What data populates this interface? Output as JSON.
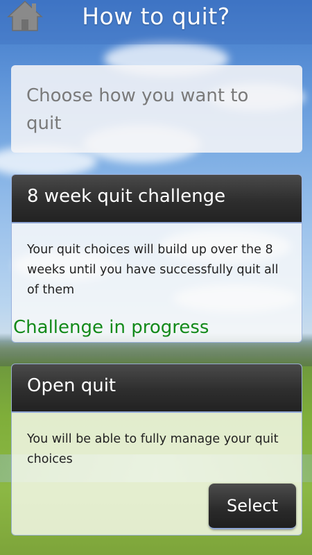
{
  "header": {
    "title": "How to quit?",
    "home_icon": "home-icon"
  },
  "prompt": {
    "text": "Choose how you want to quit"
  },
  "options": [
    {
      "title": "8 week quit challenge",
      "description": "Your quit choices will build up over the 8 weeks until you have successfully quit all of them",
      "status": "Challenge in progress",
      "status_color": "#138a1a"
    },
    {
      "title": "Open quit",
      "description": "You will be able to fully manage your quit choices",
      "button_label": "Select"
    }
  ],
  "colors": {
    "card_header": "#2e2e2e",
    "accent_border": "#8fa6d6"
  }
}
